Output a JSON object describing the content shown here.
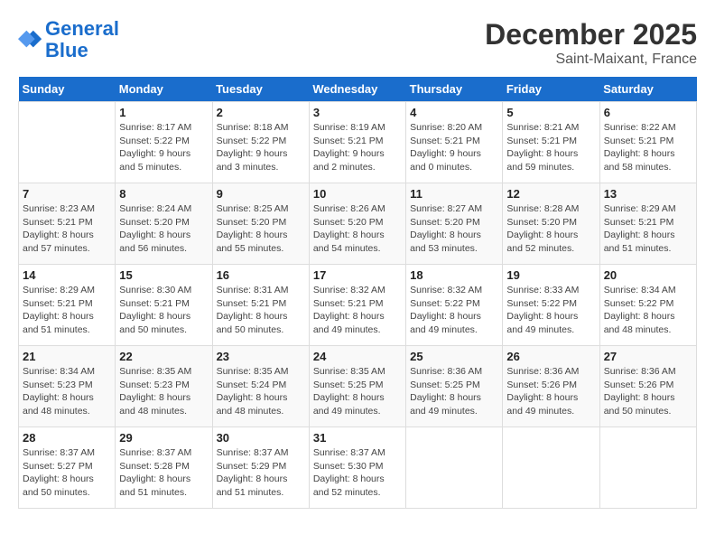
{
  "header": {
    "logo_line1": "General",
    "logo_line2": "Blue",
    "month_title": "December 2025",
    "location": "Saint-Maixant, France"
  },
  "weekdays": [
    "Sunday",
    "Monday",
    "Tuesday",
    "Wednesday",
    "Thursday",
    "Friday",
    "Saturday"
  ],
  "weeks": [
    [
      {
        "day": "",
        "info": ""
      },
      {
        "day": "1",
        "info": "Sunrise: 8:17 AM\nSunset: 5:22 PM\nDaylight: 9 hours\nand 5 minutes."
      },
      {
        "day": "2",
        "info": "Sunrise: 8:18 AM\nSunset: 5:22 PM\nDaylight: 9 hours\nand 3 minutes."
      },
      {
        "day": "3",
        "info": "Sunrise: 8:19 AM\nSunset: 5:21 PM\nDaylight: 9 hours\nand 2 minutes."
      },
      {
        "day": "4",
        "info": "Sunrise: 8:20 AM\nSunset: 5:21 PM\nDaylight: 9 hours\nand 0 minutes."
      },
      {
        "day": "5",
        "info": "Sunrise: 8:21 AM\nSunset: 5:21 PM\nDaylight: 8 hours\nand 59 minutes."
      },
      {
        "day": "6",
        "info": "Sunrise: 8:22 AM\nSunset: 5:21 PM\nDaylight: 8 hours\nand 58 minutes."
      }
    ],
    [
      {
        "day": "7",
        "info": "Sunrise: 8:23 AM\nSunset: 5:21 PM\nDaylight: 8 hours\nand 57 minutes."
      },
      {
        "day": "8",
        "info": "Sunrise: 8:24 AM\nSunset: 5:20 PM\nDaylight: 8 hours\nand 56 minutes."
      },
      {
        "day": "9",
        "info": "Sunrise: 8:25 AM\nSunset: 5:20 PM\nDaylight: 8 hours\nand 55 minutes."
      },
      {
        "day": "10",
        "info": "Sunrise: 8:26 AM\nSunset: 5:20 PM\nDaylight: 8 hours\nand 54 minutes."
      },
      {
        "day": "11",
        "info": "Sunrise: 8:27 AM\nSunset: 5:20 PM\nDaylight: 8 hours\nand 53 minutes."
      },
      {
        "day": "12",
        "info": "Sunrise: 8:28 AM\nSunset: 5:20 PM\nDaylight: 8 hours\nand 52 minutes."
      },
      {
        "day": "13",
        "info": "Sunrise: 8:29 AM\nSunset: 5:21 PM\nDaylight: 8 hours\nand 51 minutes."
      }
    ],
    [
      {
        "day": "14",
        "info": "Sunrise: 8:29 AM\nSunset: 5:21 PM\nDaylight: 8 hours\nand 51 minutes."
      },
      {
        "day": "15",
        "info": "Sunrise: 8:30 AM\nSunset: 5:21 PM\nDaylight: 8 hours\nand 50 minutes."
      },
      {
        "day": "16",
        "info": "Sunrise: 8:31 AM\nSunset: 5:21 PM\nDaylight: 8 hours\nand 50 minutes."
      },
      {
        "day": "17",
        "info": "Sunrise: 8:32 AM\nSunset: 5:21 PM\nDaylight: 8 hours\nand 49 minutes."
      },
      {
        "day": "18",
        "info": "Sunrise: 8:32 AM\nSunset: 5:22 PM\nDaylight: 8 hours\nand 49 minutes."
      },
      {
        "day": "19",
        "info": "Sunrise: 8:33 AM\nSunset: 5:22 PM\nDaylight: 8 hours\nand 49 minutes."
      },
      {
        "day": "20",
        "info": "Sunrise: 8:34 AM\nSunset: 5:22 PM\nDaylight: 8 hours\nand 48 minutes."
      }
    ],
    [
      {
        "day": "21",
        "info": "Sunrise: 8:34 AM\nSunset: 5:23 PM\nDaylight: 8 hours\nand 48 minutes."
      },
      {
        "day": "22",
        "info": "Sunrise: 8:35 AM\nSunset: 5:23 PM\nDaylight: 8 hours\nand 48 minutes."
      },
      {
        "day": "23",
        "info": "Sunrise: 8:35 AM\nSunset: 5:24 PM\nDaylight: 8 hours\nand 48 minutes."
      },
      {
        "day": "24",
        "info": "Sunrise: 8:35 AM\nSunset: 5:25 PM\nDaylight: 8 hours\nand 49 minutes."
      },
      {
        "day": "25",
        "info": "Sunrise: 8:36 AM\nSunset: 5:25 PM\nDaylight: 8 hours\nand 49 minutes."
      },
      {
        "day": "26",
        "info": "Sunrise: 8:36 AM\nSunset: 5:26 PM\nDaylight: 8 hours\nand 49 minutes."
      },
      {
        "day": "27",
        "info": "Sunrise: 8:36 AM\nSunset: 5:26 PM\nDaylight: 8 hours\nand 50 minutes."
      }
    ],
    [
      {
        "day": "28",
        "info": "Sunrise: 8:37 AM\nSunset: 5:27 PM\nDaylight: 8 hours\nand 50 minutes."
      },
      {
        "day": "29",
        "info": "Sunrise: 8:37 AM\nSunset: 5:28 PM\nDaylight: 8 hours\nand 51 minutes."
      },
      {
        "day": "30",
        "info": "Sunrise: 8:37 AM\nSunset: 5:29 PM\nDaylight: 8 hours\nand 51 minutes."
      },
      {
        "day": "31",
        "info": "Sunrise: 8:37 AM\nSunset: 5:30 PM\nDaylight: 8 hours\nand 52 minutes."
      },
      {
        "day": "",
        "info": ""
      },
      {
        "day": "",
        "info": ""
      },
      {
        "day": "",
        "info": ""
      }
    ]
  ]
}
